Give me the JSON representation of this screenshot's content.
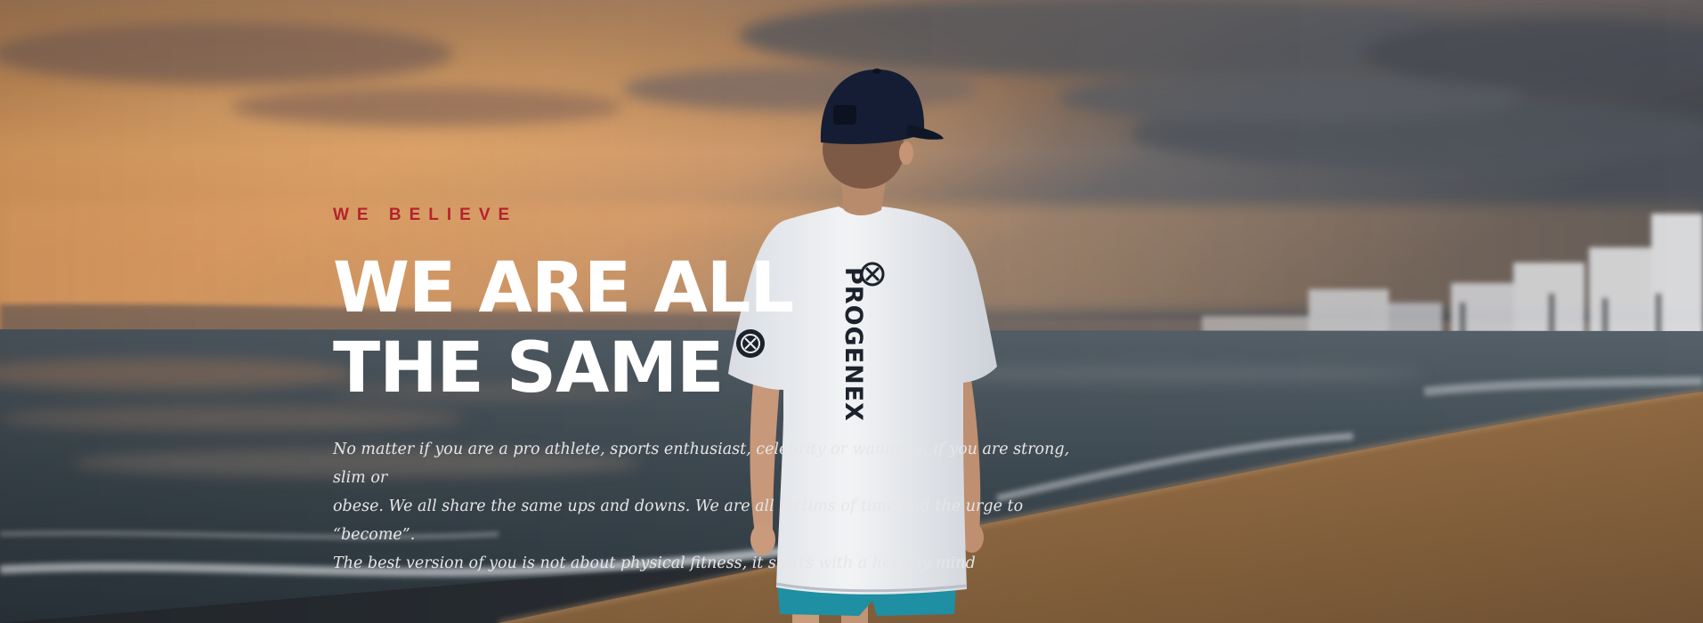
{
  "hero": {
    "eyebrow": "WE BELIEVE",
    "headline_line1": "WE ARE ALL",
    "headline_line2": "THE SAME",
    "body_lines": [
      "No matter if you are a pro athlete, sports enthusiast, celebrity or wannabe, if you are strong, slim or",
      "obese. We all share the same ups and downs. We are all victims of time and the urge to “become”.",
      "The best version of you is not about physical fitness, it starts with a healthy mind"
    ],
    "shirt_brand": "PROGENEX"
  },
  "colors": {
    "accent": "#b3232e",
    "headline": "#ffffff",
    "body_text": "#e6e6e6",
    "sky_warm": "#f2a35e",
    "sky_dark": "#4a5058",
    "sea": "#3c4a52",
    "sand": "#8a6640",
    "shirt": "#eef0f3",
    "cap": "#141d33",
    "shorts": "#1f8fa3"
  }
}
